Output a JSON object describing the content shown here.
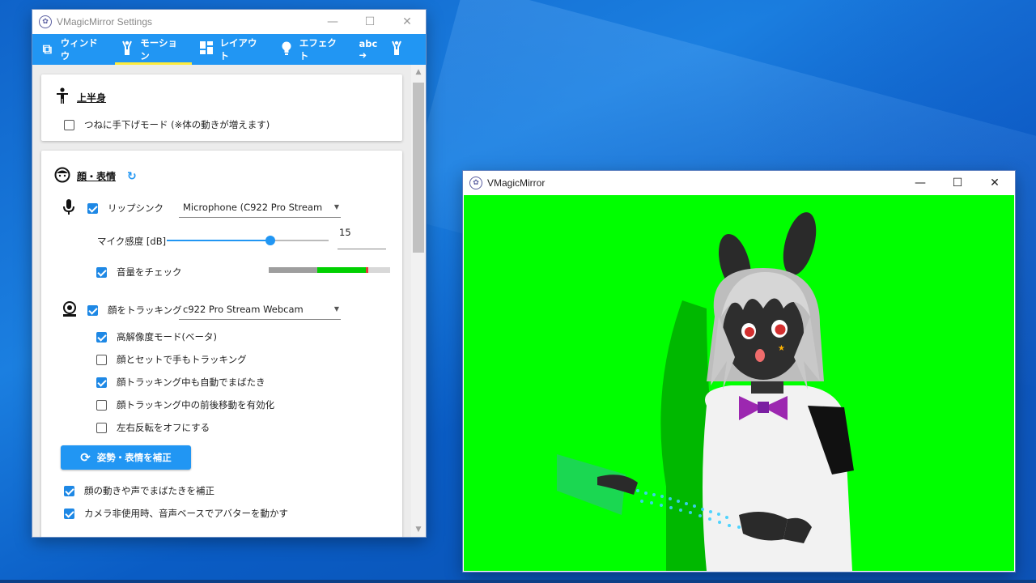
{
  "settings_window": {
    "title": "VMagicMirror Settings",
    "controls": {
      "minimize": "—",
      "maximize": "☐",
      "close": "✕"
    },
    "tabs": [
      {
        "label": "ウィンドウ",
        "icon": "window-icon",
        "glyph": "⧉"
      },
      {
        "label": "モーション",
        "icon": "person-arms-up-icon",
        "glyph": "🙌"
      },
      {
        "label": "レイアウト",
        "icon": "layout-grid-icon",
        "glyph": "▦"
      },
      {
        "label": "エフェクト",
        "icon": "lightbulb-icon",
        "glyph": "💡"
      },
      {
        "label": "abc ➜",
        "icon": "person-arms-up-icon",
        "glyph": "🙌"
      }
    ],
    "upper_body": {
      "heading": "上半身",
      "always_hands_down": {
        "label": "つねに手下げモード (※体の動きが増えます)",
        "checked": false
      }
    },
    "face": {
      "heading": "顔・表情",
      "lipsync": {
        "label": "リップシンク",
        "checked": true,
        "device": "Microphone (C922 Pro Stream"
      },
      "mic_sensitivity": {
        "label": "マイク感度 [dB]",
        "value": "15",
        "slider_fraction": 0.7
      },
      "check_volume": {
        "label": "音量をチェック",
        "checked": true
      },
      "face_tracking": {
        "label": "顔をトラッキング",
        "checked": true,
        "device": "c922 Pro Stream Webcam"
      },
      "options": [
        {
          "label": "高解像度モード(ベータ)",
          "checked": true
        },
        {
          "label": "顔とセットで手もトラッキング",
          "checked": false
        },
        {
          "label": "顔トラッキング中も自動でまばたき",
          "checked": true
        },
        {
          "label": "顔トラッキング中の前後移動を有効化",
          "checked": false
        },
        {
          "label": "左右反転をオフにする",
          "checked": false
        }
      ],
      "calibrate_button": "姿勢・表情を補正",
      "blink_adjust": {
        "label": "顔の動きや声でまばたきを補正",
        "checked": true
      },
      "voice_based_motion": {
        "label": "カメラ非使用時、音声ベースでアバターを動かす",
        "checked": true
      }
    }
  },
  "mirror_window": {
    "title": "VMagicMirror",
    "controls": {
      "minimize": "—",
      "maximize": "☐",
      "close": "✕"
    },
    "background_color": "#00ff00"
  },
  "colors": {
    "accent": "#2196f3",
    "tab_indicator": "#ffeb3b",
    "checkbox": "#1e88e5"
  }
}
